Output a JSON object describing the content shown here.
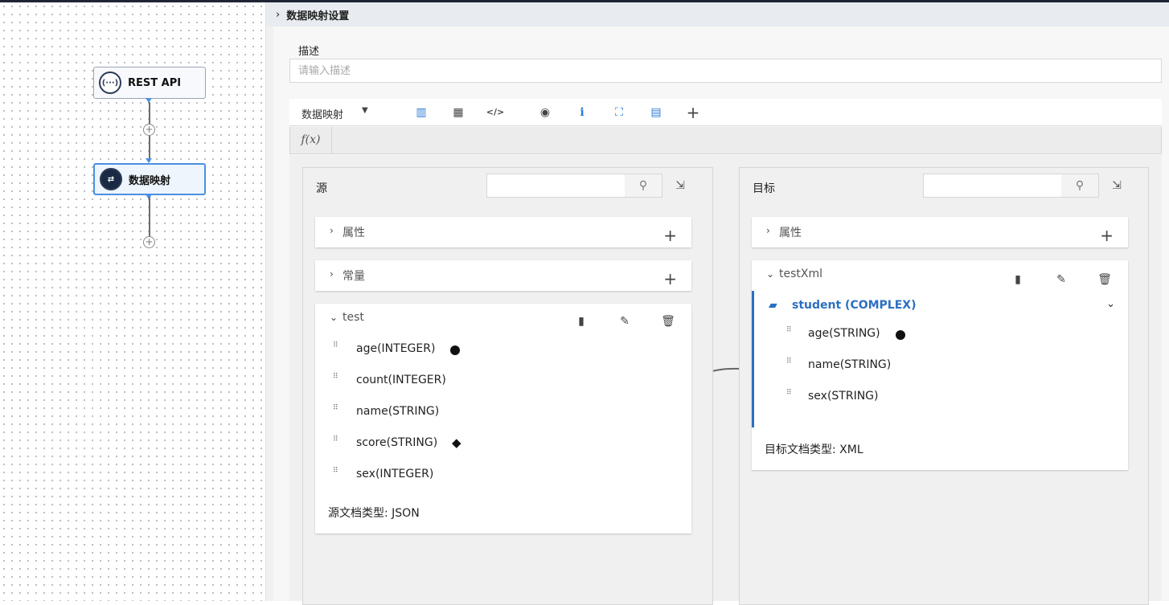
{
  "flow": {
    "nodes": [
      {
        "label": "REST API",
        "icon": "api-icon"
      },
      {
        "label": "数据映射",
        "icon": "mapping-icon"
      }
    ]
  },
  "panel": {
    "title": "数据映射设置",
    "description_label": "描述",
    "description_placeholder": "请输入描述",
    "toolbar": {
      "mode_select": "数据映射",
      "buttons": [
        "columns-icon",
        "table-icon",
        "code-icon",
        "eye-icon",
        "info-icon",
        "map-marker-icon",
        "map-icon",
        "plus-icon"
      ]
    },
    "fx_label": "f(x)"
  },
  "source": {
    "title": "源",
    "properties_label": "属性",
    "constants_label": "常量",
    "doc_name": "test",
    "fields": [
      "age(INTEGER)",
      "count(INTEGER)",
      "name(STRING)",
      "score(STRING)",
      "sex(INTEGER)"
    ],
    "doc_type": "源文档类型: JSON"
  },
  "target": {
    "title": "目标",
    "properties_label": "属性",
    "doc_name": "testXml",
    "complex_name": "student (COMPLEX)",
    "fields": [
      "age(STRING)",
      "name(STRING)",
      "sex(STRING)"
    ],
    "doc_type": "目标文档类型: XML"
  },
  "colors": {
    "accent": "#2c6fc1",
    "toolbar_icon": "#2b7bd6",
    "node_border": "#4a90e2"
  }
}
